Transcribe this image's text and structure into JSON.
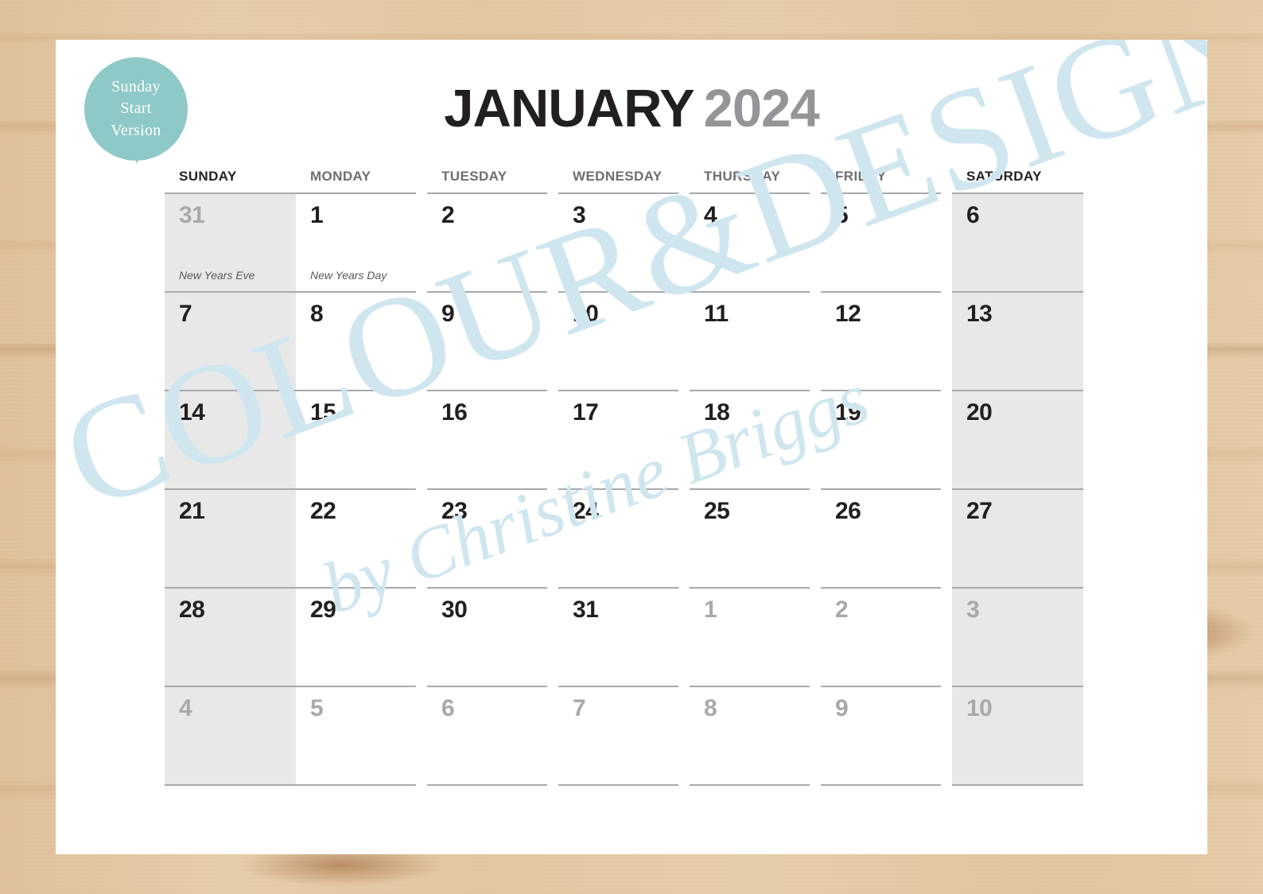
{
  "badge": {
    "line1": "Sunday",
    "line2": "Start",
    "line3": "Version",
    "color": "#8ec9c8"
  },
  "title": {
    "month": "JANUARY",
    "year": "2024",
    "month_color": "#231f20",
    "year_color": "#939598"
  },
  "watermark": {
    "main": "COLOUR&DESIGN",
    "sub": "by Christine Briggs",
    "color": "#cfe6ef"
  },
  "calendar": {
    "weekday_headers": [
      "SUNDAY",
      "MONDAY",
      "TUESDAY",
      "WEDNESDAY",
      "THURSDAY",
      "FRIDAY",
      "SATURDAY"
    ],
    "weeks": [
      [
        {
          "day": "31",
          "muted": true,
          "event": "New Years Eve"
        },
        {
          "day": "1",
          "muted": false,
          "event": "New Years Day"
        },
        {
          "day": "2",
          "muted": false,
          "event": ""
        },
        {
          "day": "3",
          "muted": false,
          "event": ""
        },
        {
          "day": "4",
          "muted": false,
          "event": ""
        },
        {
          "day": "5",
          "muted": false,
          "event": ""
        },
        {
          "day": "6",
          "muted": false,
          "event": ""
        }
      ],
      [
        {
          "day": "7",
          "muted": false,
          "event": ""
        },
        {
          "day": "8",
          "muted": false,
          "event": ""
        },
        {
          "day": "9",
          "muted": false,
          "event": ""
        },
        {
          "day": "10",
          "muted": false,
          "event": ""
        },
        {
          "day": "11",
          "muted": false,
          "event": ""
        },
        {
          "day": "12",
          "muted": false,
          "event": ""
        },
        {
          "day": "13",
          "muted": false,
          "event": ""
        }
      ],
      [
        {
          "day": "14",
          "muted": false,
          "event": ""
        },
        {
          "day": "15",
          "muted": false,
          "event": ""
        },
        {
          "day": "16",
          "muted": false,
          "event": ""
        },
        {
          "day": "17",
          "muted": false,
          "event": ""
        },
        {
          "day": "18",
          "muted": false,
          "event": ""
        },
        {
          "day": "19",
          "muted": false,
          "event": ""
        },
        {
          "day": "20",
          "muted": false,
          "event": ""
        }
      ],
      [
        {
          "day": "21",
          "muted": false,
          "event": ""
        },
        {
          "day": "22",
          "muted": false,
          "event": ""
        },
        {
          "day": "23",
          "muted": false,
          "event": ""
        },
        {
          "day": "24",
          "muted": false,
          "event": ""
        },
        {
          "day": "25",
          "muted": false,
          "event": ""
        },
        {
          "day": "26",
          "muted": false,
          "event": ""
        },
        {
          "day": "27",
          "muted": false,
          "event": ""
        }
      ],
      [
        {
          "day": "28",
          "muted": false,
          "event": ""
        },
        {
          "day": "29",
          "muted": false,
          "event": ""
        },
        {
          "day": "30",
          "muted": false,
          "event": ""
        },
        {
          "day": "31",
          "muted": false,
          "event": ""
        },
        {
          "day": "1",
          "muted": true,
          "event": ""
        },
        {
          "day": "2",
          "muted": true,
          "event": ""
        },
        {
          "day": "3",
          "muted": true,
          "event": ""
        }
      ],
      [
        {
          "day": "4",
          "muted": true,
          "event": ""
        },
        {
          "day": "5",
          "muted": true,
          "event": ""
        },
        {
          "day": "6",
          "muted": true,
          "event": ""
        },
        {
          "day": "7",
          "muted": true,
          "event": ""
        },
        {
          "day": "8",
          "muted": true,
          "event": ""
        },
        {
          "day": "9",
          "muted": true,
          "event": ""
        },
        {
          "day": "10",
          "muted": true,
          "event": ""
        }
      ]
    ],
    "weekend_columns": [
      0,
      6
    ],
    "weekend_shade": "#e8e8e8",
    "rule_color": "#a7a9ac"
  }
}
